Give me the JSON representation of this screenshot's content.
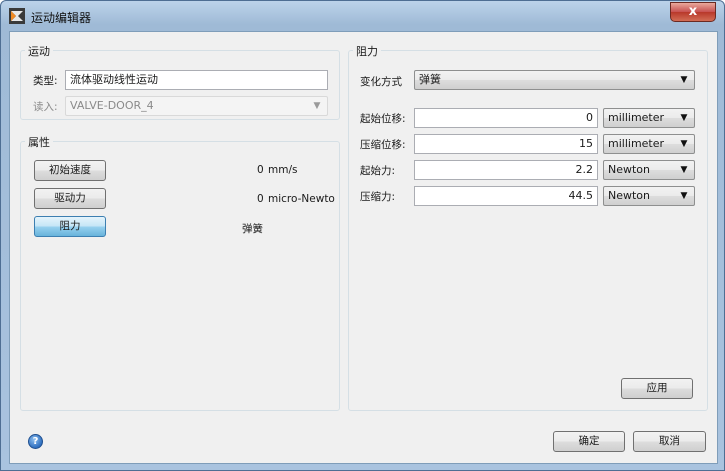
{
  "window": {
    "title": "运动编辑器",
    "close_label": "x"
  },
  "motion": {
    "section_title": "运动",
    "type_label": "类型:",
    "type_value": "流体驱动线性运动",
    "read_label": "读入:",
    "read_value": "VALVE-DOOR_4"
  },
  "properties": {
    "section_title": "属性",
    "rows": [
      {
        "button": "初始速度",
        "value": "0",
        "unit": "mm/s"
      },
      {
        "button": "驱动力",
        "value": "0",
        "unit": "micro-Newto"
      },
      {
        "button": "阻力",
        "value": "弹簧",
        "unit": ""
      }
    ]
  },
  "resistance": {
    "section_title": "阻力",
    "mode_label": "变化方式",
    "mode_value": "弹簧",
    "fields": [
      {
        "label": "起始位移:",
        "value": "0",
        "unit": "millimeter"
      },
      {
        "label": "压缩位移:",
        "value": "15",
        "unit": "millimeter"
      },
      {
        "label": "起始力:",
        "value": "2.2",
        "unit": "Newton"
      },
      {
        "label": "压缩力:",
        "value": "44.5",
        "unit": "Newton"
      }
    ],
    "apply_label": "应用"
  },
  "footer": {
    "help_icon": "?",
    "ok_label": "确定",
    "cancel_label": "取消"
  },
  "icons": {
    "app": "app-logo-icon",
    "help": "help-icon",
    "dropdown": "chevron-down-icon"
  },
  "colors": {
    "accent_button": "#98d1ef",
    "close_button": "#c75050",
    "title_gradient": "#a9c3df"
  }
}
